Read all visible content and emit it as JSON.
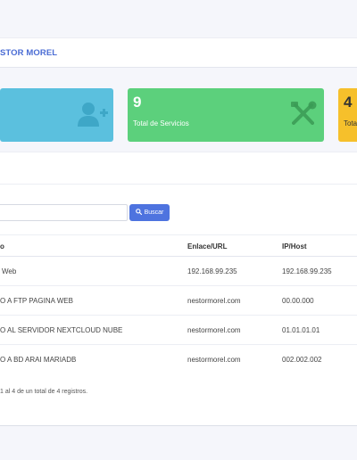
{
  "header": {
    "title": "STOR MOREL"
  },
  "stats": [
    {
      "number": "",
      "label": "",
      "icon": "add-user-icon",
      "color": "#5bc0de"
    },
    {
      "number": "9",
      "label": "Total de Servicios",
      "icon": "tools-icon",
      "color": "#5cd07c"
    },
    {
      "number": "4",
      "label": "Tota",
      "icon": "",
      "color": "#f6c02b"
    }
  ],
  "search": {
    "placeholder": "",
    "button_label": "Buscar",
    "button_icon": "search-icon"
  },
  "table": {
    "columns": [
      "o",
      "Enlace/URL",
      "IP/Host"
    ],
    "rows": [
      {
        "name": "Web",
        "url": "192.168.99.235",
        "host": "192.168.99.235"
      },
      {
        "name": "O A FTP PAGINA WEB",
        "url": "nestormorel.com",
        "host": "00.00.000"
      },
      {
        "name": "O AL SERVIDOR NEXTCLOUD NUBE",
        "url": "nestormorel.com",
        "host": "01.01.01.01"
      },
      {
        "name": "O A BD ARAI MARIADB",
        "url": "nestormorel.com",
        "host": "002.002.002"
      }
    ]
  },
  "footer": {
    "info": "1 al 4 de un total de 4 registros."
  }
}
